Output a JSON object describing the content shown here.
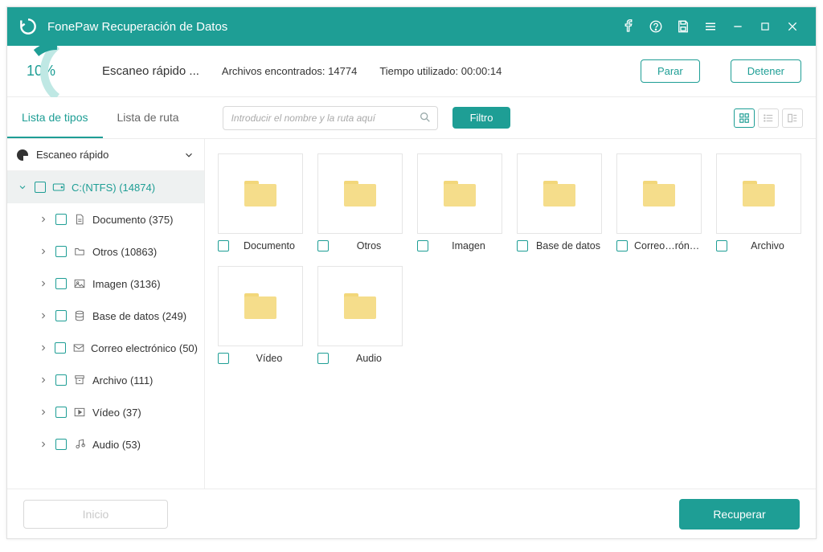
{
  "app": {
    "title": "FonePaw Recuperación de Datos"
  },
  "status": {
    "percent": "10%",
    "scan_label": "Escaneo rápido ...",
    "found_label": "Archivos encontrados: 14774",
    "time_label": "Tiempo utilizado: 00:00:14",
    "pause": "Parar",
    "stop": "Detener"
  },
  "toolbar": {
    "tab_types": "Lista de tipos",
    "tab_paths": "Lista de ruta",
    "search_placeholder": "Introducir el nombre y la ruta aquí",
    "filter": "Filtro"
  },
  "tree": {
    "head": "Escaneo rápido",
    "drive": "C:(NTFS) (14874)",
    "items": [
      {
        "label": "Documento (375)"
      },
      {
        "label": "Otros (10863)"
      },
      {
        "label": "Imagen (3136)"
      },
      {
        "label": "Base de datos (249)"
      },
      {
        "label": "Correo electrónico (50)"
      },
      {
        "label": "Archivo (111)"
      },
      {
        "label": "Vídeo (37)"
      },
      {
        "label": "Audio (53)"
      }
    ]
  },
  "cards": [
    {
      "label": "Documento"
    },
    {
      "label": "Otros"
    },
    {
      "label": "Imagen"
    },
    {
      "label": "Base de datos"
    },
    {
      "label": "Correo…rónico"
    },
    {
      "label": "Archivo"
    },
    {
      "label": "Vídeo"
    },
    {
      "label": "Audio"
    }
  ],
  "footer": {
    "start": "Inicio",
    "recover": "Recuperar"
  },
  "colors": {
    "accent": "#1e9e95"
  }
}
